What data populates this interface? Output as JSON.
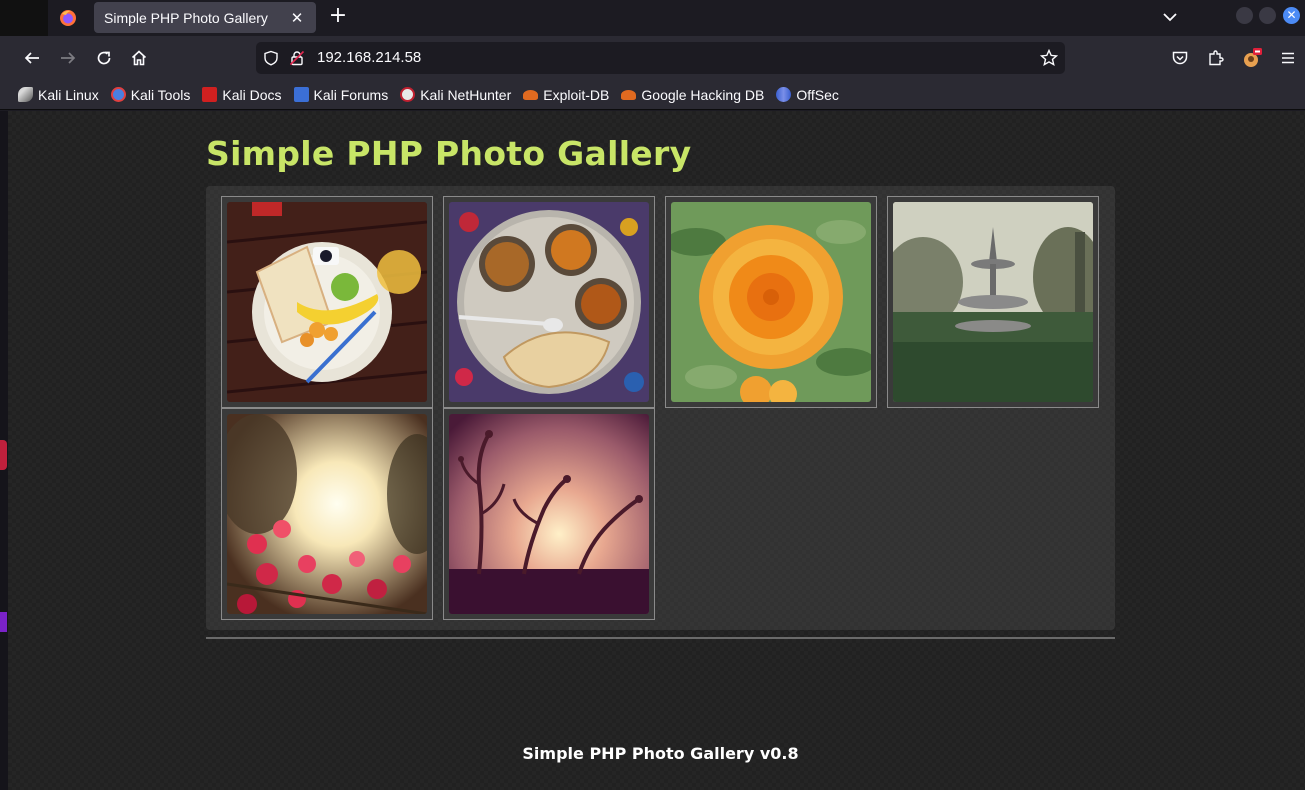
{
  "browser": {
    "tab": {
      "title": "Simple PHP Photo Gallery",
      "close_glyph": "✕"
    },
    "new_tab_glyph": "+",
    "url": "192.168.214.58",
    "bookmarks": [
      {
        "label": "Kali Linux",
        "icon": "kali-dragon-icon",
        "color": "#cfcfcf"
      },
      {
        "label": "Kali Tools",
        "icon": "kali-tools-icon",
        "color": "#4a7fe0"
      },
      {
        "label": "Kali Docs",
        "icon": "kali-docs-icon",
        "color": "#d02020"
      },
      {
        "label": "Kali Forums",
        "icon": "kali-forums-icon",
        "color": "#3b6fd6"
      },
      {
        "label": "Kali NetHunter",
        "icon": "nethunter-icon",
        "color": "#e0e0e0"
      },
      {
        "label": "Exploit-DB",
        "icon": "exploit-db-icon",
        "color": "#e06a20"
      },
      {
        "label": "Google Hacking DB",
        "icon": "ghdb-icon",
        "color": "#e06a20"
      },
      {
        "label": "OffSec",
        "icon": "offsec-icon",
        "color": "#4a6fd8"
      }
    ]
  },
  "page": {
    "title": "Simple PHP Photo Gallery",
    "footer": "Simple PHP Photo Gallery v0.8",
    "title_color": "#c8e567",
    "photos": [
      {
        "name": "photo-breakfast",
        "subject": "breakfast plate with bread, banana and lime"
      },
      {
        "name": "photo-thali",
        "subject": "thali with curries and chapati"
      },
      {
        "name": "photo-orange-flower",
        "subject": "orange marigold flower"
      },
      {
        "name": "photo-fountain",
        "subject": "garden fountain"
      },
      {
        "name": "photo-bougainvillea",
        "subject": "red flowers in sunlight"
      },
      {
        "name": "photo-sunset-plants",
        "subject": "plant silhouettes at sunset"
      }
    ]
  }
}
